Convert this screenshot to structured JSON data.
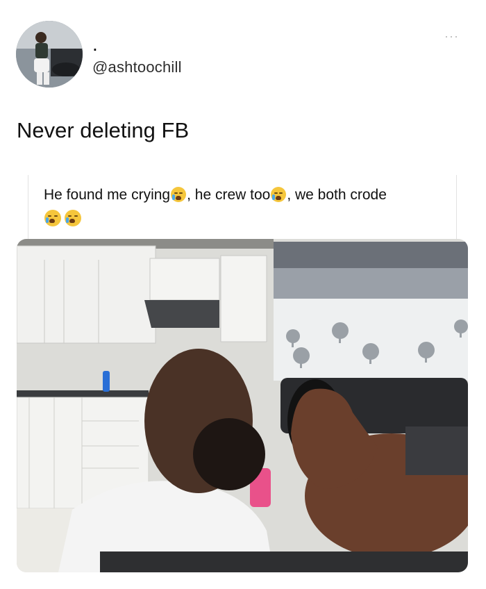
{
  "tweet": {
    "display_name": ".",
    "handle": "@ashtoochill",
    "more_label": "···",
    "text": "Never deleting FB"
  },
  "quoted": {
    "part1": "He found me crying",
    "part2": ", he crew too",
    "part3": ", we both crode",
    "emoji_name": "loudly-crying-face-emoji"
  },
  "media": {
    "type": "photo"
  },
  "colors": {
    "background": "#ffffff",
    "text": "#111111",
    "handle": "#2d2d2d",
    "divider": "#e2e2e2"
  }
}
